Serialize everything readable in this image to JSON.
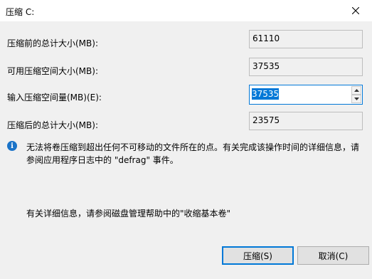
{
  "window": {
    "title": "压缩 C:"
  },
  "fields": {
    "total_before": {
      "label": "压缩前的总计大小(MB):",
      "value": "61110"
    },
    "available": {
      "label": "可用压缩空间大小(MB):",
      "value": "37535"
    },
    "amount": {
      "label": "输入压缩空间量(MB)(E):",
      "value": "37535"
    },
    "total_after": {
      "label": "压缩后的总计大小(MB):",
      "value": "23575"
    }
  },
  "info": {
    "icon": "info-icon",
    "text": "无法将卷压缩到超出任何不可移动的文件所在的点。有关完成该操作时间的详细信息，请参阅应用程序日志中的 \"defrag\" 事件。"
  },
  "help": {
    "text": "有关详细信息，请参阅磁盘管理帮助中的\"收缩基本卷\""
  },
  "buttons": {
    "shrink": "压缩(S)",
    "cancel": "取消(C)"
  },
  "colors": {
    "accent": "#0078d7",
    "client_bg": "#f0f0f0",
    "info_icon": "#1a73c8"
  }
}
